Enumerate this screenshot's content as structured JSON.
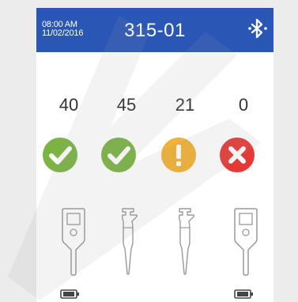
{
  "header": {
    "time": "08:00 AM",
    "date": "11/02/2016",
    "device_id": "315-01",
    "bluetooth_icon": "bluetooth-icon"
  },
  "counts": [
    "40",
    "45",
    "21",
    "0"
  ],
  "status": [
    {
      "icon": "check-icon",
      "color": "#7cb342"
    },
    {
      "icon": "check-icon",
      "color": "#7cb342"
    },
    {
      "icon": "warning-icon",
      "color": "#f2b233"
    },
    {
      "icon": "error-x-icon",
      "color": "#e53935"
    }
  ],
  "devices": [
    {
      "icon": "handheld-pipette-controller-icon",
      "battery": true
    },
    {
      "icon": "pipette-icon",
      "battery": false
    },
    {
      "icon": "pipette-icon",
      "battery": false
    },
    {
      "icon": "handheld-pipette-controller-icon",
      "battery": true
    }
  ],
  "colors": {
    "header_bg": "#2a56b6",
    "success": "#7cb342",
    "warning": "#f2b233",
    "error": "#e53935"
  }
}
